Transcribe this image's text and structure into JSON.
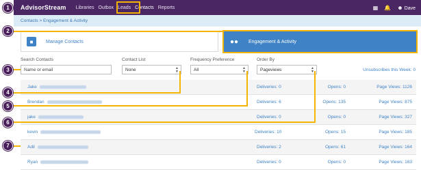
{
  "topbar": {
    "brand": "AdvisorStream",
    "nav": [
      "Libraries",
      "Outbox",
      "Leads",
      "Contacts",
      "Reports"
    ],
    "active_nav": "Contacts",
    "user": "Dave",
    "grid_icon": "grid-icon",
    "bell_icon": "bell-icon",
    "user_icon": "user-icon"
  },
  "breadcrumb": "Contacts > Engagement & Activity",
  "tabs": {
    "manage": {
      "label": "Manage Contacts",
      "icon": "address-card-icon"
    },
    "engage": {
      "label": "Engagement & Activity",
      "icon": "users-icon"
    }
  },
  "filters": {
    "search": {
      "label": "Search Contacts",
      "placeholder": "Name or email"
    },
    "contact_list": {
      "label": "Contact List",
      "value": "None"
    },
    "frequency": {
      "label": "Frequency Preference",
      "value": "All"
    },
    "order_by": {
      "label": "Order By",
      "value": "Pageviews"
    },
    "unsubscribes": "Unsubscribes this Week: 0"
  },
  "rows": [
    {
      "name": "Jake",
      "deliveries": "Deliveries: 0",
      "opens": "Opens: 0",
      "pageviews": "Page Views: 1126"
    },
    {
      "name": "Brendan",
      "deliveries": "Deliveries: 6",
      "opens": "Opens: 135",
      "pageviews": "Page Views: 875"
    },
    {
      "name": "jake",
      "deliveries": "Deliveries: 0",
      "opens": "Opens: 0",
      "pageviews": "Page Views: 327"
    },
    {
      "name": "kevin",
      "deliveries": "Deliveries: 10",
      "opens": "Opens: 15",
      "pageviews": "Page Views: 185"
    },
    {
      "name": "Adil",
      "deliveries": "Deliveries: 2",
      "opens": "Opens: 61",
      "pageviews": "Page Views: 164"
    },
    {
      "name": "Ryan",
      "deliveries": "Deliveries: 0",
      "opens": "Opens: 0",
      "pageviews": "Page Views: 163"
    }
  ],
  "markers": [
    "1",
    "2",
    "3",
    "4",
    "5",
    "6",
    "7"
  ],
  "colors": {
    "topbar": "#4a2663",
    "accent": "#3f83c6",
    "highlight": "#f4b400",
    "breadcrumb_bg": "#dcecf6"
  }
}
